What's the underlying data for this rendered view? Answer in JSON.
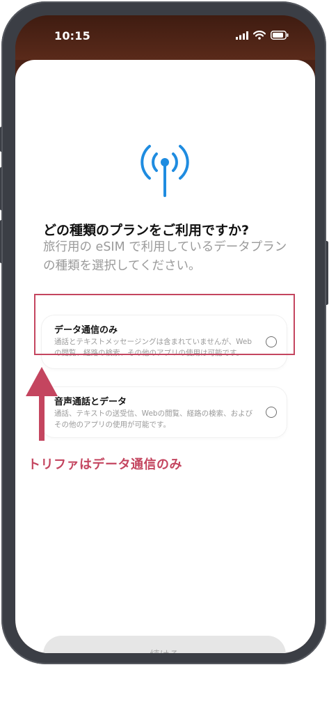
{
  "status_bar": {
    "time": "10:15"
  },
  "question": {
    "title": "どの種類のプランをご利用ですか?",
    "subtitle": "旅行用の eSIM で利用しているデータプランの種類を選択してください。"
  },
  "options": [
    {
      "title": "データ通信のみ",
      "description": "通話とテキストメッセージングは含まれていませんが、Webの閲覧、経路の検索、その他のアプリの使用は可能です。",
      "selected": false
    },
    {
      "title": "音声通話とデータ",
      "description": "通話、テキストの送受信、Webの閲覧、経路の検索、およびその他のアプリの使用が可能です。",
      "selected": false
    }
  ],
  "annotation": {
    "note": "トリファはデータ通信のみ"
  },
  "footer": {
    "continue_label": "続ける"
  },
  "colors": {
    "accent_blue": "#1f8ce0",
    "annotation_red": "#c4455f",
    "status_bar_bg": "#4a2216"
  }
}
